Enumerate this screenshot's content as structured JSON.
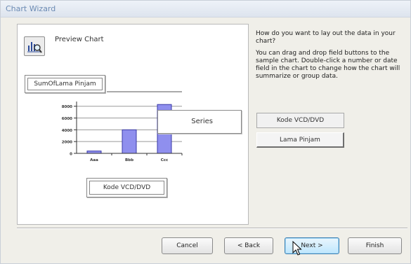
{
  "window": {
    "title": "Chart Wizard"
  },
  "preview": {
    "label": "Preview Chart",
    "icon": "chart-magnifier-icon"
  },
  "drop_zones": {
    "data_field": "SumOfLama Pinjam",
    "axis_field": "Kode VCD/DVD",
    "series_field": "Series"
  },
  "chart_data": {
    "type": "bar",
    "categories": [
      "Aaa",
      "Bbb",
      "Ccc"
    ],
    "values": [
      400,
      4000,
      8300
    ],
    "yticks": [
      0,
      2000,
      4000,
      6000,
      8000
    ],
    "ylim": [
      0,
      8800
    ],
    "color": "#8f8fee",
    "grid": true
  },
  "instructions": {
    "question": "How do you want to lay out the data in your chart?",
    "help": "You can drag and drop field buttons to the sample chart. Double-click a number or date field in the chart to change how the chart will summarize or group data."
  },
  "fields": [
    {
      "label": "Kode VCD/DVD",
      "state": "used"
    },
    {
      "label": "Lama Pinjam",
      "state": "available"
    }
  ],
  "buttons": {
    "cancel": "Cancel",
    "back": "< Back",
    "next": "Next >",
    "finish": "Finish"
  }
}
